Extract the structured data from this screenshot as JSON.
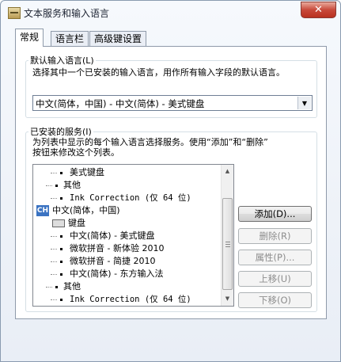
{
  "window": {
    "title": "文本服务和输入语言",
    "close_glyph": "✕"
  },
  "tabs": [
    {
      "label": "常规",
      "active": true
    },
    {
      "label": "语言栏",
      "active": false
    },
    {
      "label": "高级键设置",
      "active": false
    }
  ],
  "default_language": {
    "group_title": "默认输入语言(L)",
    "description": "选择其中一个已安装的输入语言，用作所有输入字段的默认语言。",
    "selected": "中文(简体，中国) - 中文(简体) - 美式键盘",
    "arrow_icon": "chevron-down-icon"
  },
  "installed_services": {
    "group_title": "已安装的服务(I)",
    "description_line1": "为列表中显示的每个输入语言选择服务。使用“添加”和“删除”",
    "description_line2": "按钮来修改这个列表。",
    "tree_items": [
      {
        "label": "美式键盘",
        "kind": "bullet",
        "mono": false
      },
      {
        "label": "其他",
        "kind": "branch",
        "mono": false
      },
      {
        "label": "Ink Correction (仅 64 位)",
        "kind": "bullet",
        "mono": true
      },
      {
        "label": "中文(简体，中国)",
        "kind": "language",
        "badge": "CH",
        "mono": false
      },
      {
        "label": "键盘",
        "kind": "keyboard",
        "icon": "keyboard-icon",
        "mono": false
      },
      {
        "label": "中文(简体) - 美式键盘",
        "kind": "bullet",
        "mono": false
      },
      {
        "label": "微软拼音 - 新体验 2010",
        "kind": "bullet",
        "mono": false
      },
      {
        "label": "微软拼音 - 简捷 2010",
        "kind": "bullet",
        "mono": false
      },
      {
        "label": "中文(简体) - 东方输入法",
        "kind": "bullet",
        "mono": false
      },
      {
        "label": "其他",
        "kind": "branch",
        "mono": false
      },
      {
        "label": "Ink Correction (仅 64 位)",
        "kind": "bullet",
        "mono": true
      }
    ]
  },
  "buttons": {
    "add": "添加(D)...",
    "remove": "删除(R)",
    "properties": "属性(P)...",
    "move_up": "上移(U)",
    "move_down": "下移(O)"
  },
  "colors": {
    "accent_badge": "#3b73c2",
    "close_button": "#c8493a"
  }
}
